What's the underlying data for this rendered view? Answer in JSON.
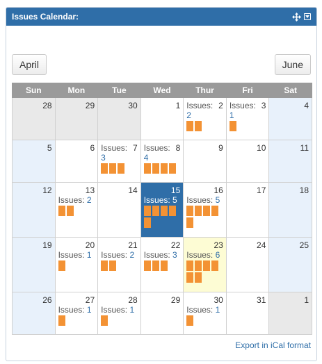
{
  "widget": {
    "title": "Issues Calendar:"
  },
  "nav": {
    "prev_label": "April",
    "next_label": "June"
  },
  "weekdays": [
    "Sun",
    "Mon",
    "Tue",
    "Wed",
    "Thur",
    "Fri",
    "Sat"
  ],
  "issues_label": "Issues:",
  "export_label": "Export in iCal format",
  "colors": {
    "header": "#2f6ea8",
    "bar": "#f39234",
    "today": "#2f6ea8",
    "highlight": "#fdfcd4"
  },
  "weeks": [
    [
      {
        "day": "28",
        "type": "other"
      },
      {
        "day": "29",
        "type": "other"
      },
      {
        "day": "30",
        "type": "other"
      },
      {
        "day": "1",
        "type": "normal"
      },
      {
        "day": "2",
        "type": "normal",
        "issues": "2",
        "bars": 2,
        "compact": true
      },
      {
        "day": "3",
        "type": "normal",
        "issues": "1",
        "bars": 1,
        "compact": true
      },
      {
        "day": "4",
        "type": "weekend"
      }
    ],
    [
      {
        "day": "5",
        "type": "weekend"
      },
      {
        "day": "6",
        "type": "normal"
      },
      {
        "day": "7",
        "type": "normal",
        "issues": "3",
        "bars": 3,
        "compact": true
      },
      {
        "day": "8",
        "type": "normal",
        "issues": "4",
        "bars": 4,
        "compact": true
      },
      {
        "day": "9",
        "type": "normal"
      },
      {
        "day": "10",
        "type": "normal"
      },
      {
        "day": "11",
        "type": "weekend"
      }
    ],
    [
      {
        "day": "12",
        "type": "weekend"
      },
      {
        "day": "13",
        "type": "normal",
        "issues": "2",
        "bars": 2
      },
      {
        "day": "14",
        "type": "normal"
      },
      {
        "day": "15",
        "type": "today",
        "issues": "5",
        "bars": 5
      },
      {
        "day": "16",
        "type": "normal",
        "issues": "5",
        "bars": 5
      },
      {
        "day": "17",
        "type": "normal"
      },
      {
        "day": "18",
        "type": "weekend"
      }
    ],
    [
      {
        "day": "19",
        "type": "weekend"
      },
      {
        "day": "20",
        "type": "normal",
        "issues": "1",
        "bars": 1
      },
      {
        "day": "21",
        "type": "normal",
        "issues": "2",
        "bars": 2
      },
      {
        "day": "22",
        "type": "normal",
        "issues": "3",
        "bars": 3
      },
      {
        "day": "23",
        "type": "highlight",
        "issues": "6",
        "bars": 6
      },
      {
        "day": "24",
        "type": "normal"
      },
      {
        "day": "25",
        "type": "weekend"
      }
    ],
    [
      {
        "day": "26",
        "type": "weekend"
      },
      {
        "day": "27",
        "type": "normal",
        "issues": "1",
        "bars": 1
      },
      {
        "day": "28",
        "type": "normal",
        "issues": "1",
        "bars": 1
      },
      {
        "day": "29",
        "type": "normal"
      },
      {
        "day": "30",
        "type": "normal",
        "issues": "1",
        "bars": 1
      },
      {
        "day": "31",
        "type": "normal"
      },
      {
        "day": "1",
        "type": "other"
      }
    ]
  ]
}
